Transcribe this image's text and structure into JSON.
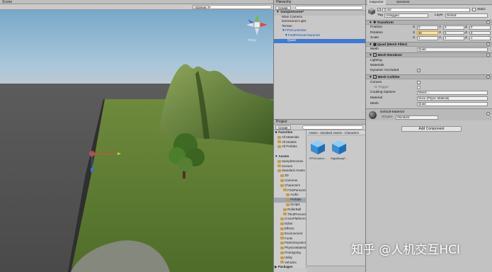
{
  "scene": {
    "tab_label": "Scene",
    "gizmos_label": "Gizmos",
    "persp_label": "Persp"
  },
  "hierarchy": {
    "tab_label": "Hierarchy",
    "create_label": "Create",
    "search_placeholder": "All",
    "scene_name": "SampleScene*",
    "items": [
      {
        "label": "Main Camera",
        "indent": 2,
        "selected": false,
        "prefab": false
      },
      {
        "label": "Directional Light",
        "indent": 2,
        "selected": false,
        "prefab": false
      },
      {
        "label": "Terrain",
        "indent": 2,
        "selected": false,
        "prefab": false
      },
      {
        "label": "▼FPSController",
        "indent": 2,
        "selected": false,
        "prefab": true
      },
      {
        "label": "▼FirstPersonCharacter",
        "indent": 3,
        "selected": false,
        "prefab": true
      },
      {
        "label": "Quad",
        "indent": 4,
        "selected": true,
        "prefab": false
      }
    ]
  },
  "project": {
    "tab_label": "Project",
    "create_label": "Create",
    "breadcrumb": "Assets › Standard Assets › Characters",
    "tree": [
      {
        "label": "★ Favorites",
        "indent": 0,
        "header": true
      },
      {
        "label": "All Materials",
        "indent": 2,
        "header": false
      },
      {
        "label": "All Models",
        "indent": 2,
        "header": false
      },
      {
        "label": "All Prefabs",
        "indent": 2,
        "header": false
      },
      {
        "label": "",
        "indent": 0,
        "header": false
      },
      {
        "label": "▼ Assets",
        "indent": 0,
        "header": true
      },
      {
        "label": "SampleScenes",
        "indent": 2,
        "header": false
      },
      {
        "label": "Scenes",
        "indent": 2,
        "header": false
      },
      {
        "label": "Standard Assets",
        "indent": 2,
        "header": false
      },
      {
        "label": "2D",
        "indent": 4,
        "header": false
      },
      {
        "label": "Cameras",
        "indent": 4,
        "header": false
      },
      {
        "label": "Characters",
        "indent": 4,
        "header": false
      },
      {
        "label": "FirstPersonCharacter",
        "indent": 6,
        "header": false
      },
      {
        "label": "Audio",
        "indent": 8,
        "header": false
      },
      {
        "label": "Prefabs",
        "indent": 8,
        "header": false,
        "selected": true
      },
      {
        "label": "Scripts",
        "indent": 8,
        "header": false
      },
      {
        "label": "RollerBall",
        "indent": 6,
        "header": false
      },
      {
        "label": "ThirdPersonCharacter",
        "indent": 6,
        "header": false
      },
      {
        "label": "CrossPlatformInput",
        "indent": 4,
        "header": false
      },
      {
        "label": "Editor",
        "indent": 4,
        "header": false
      },
      {
        "label": "Effects",
        "indent": 4,
        "header": false
      },
      {
        "label": "Environment",
        "indent": 4,
        "header": false
      },
      {
        "label": "Fonts",
        "indent": 4,
        "header": false
      },
      {
        "label": "ParticleSystems",
        "indent": 4,
        "header": false
      },
      {
        "label": "PhysicsMaterials",
        "indent": 4,
        "header": false
      },
      {
        "label": "Prototyping",
        "indent": 4,
        "header": false
      },
      {
        "label": "Utility",
        "indent": 4,
        "header": false
      },
      {
        "label": "Vehicles",
        "indent": 4,
        "header": false
      },
      {
        "label": "▶ Packages",
        "indent": 0,
        "header": true
      }
    ],
    "assets": [
      {
        "label": "FPSControl..."
      },
      {
        "label": "RigidBodyF..."
      }
    ]
  },
  "inspector": {
    "tab_label": "Inspector",
    "services_label": "Services",
    "object_name": "Quad",
    "static_label": "Static",
    "tag_label": "Tag",
    "tag_value": "Untagged",
    "layer_label": "Layer",
    "layer_value": "Default",
    "transform": {
      "title": "Transform",
      "rows": [
        {
          "label": "Position",
          "x": "0",
          "y": "0",
          "z": "0"
        },
        {
          "label": "Rotation",
          "x": "90",
          "y": "0",
          "z": "0"
        },
        {
          "label": "Scale",
          "x": "1",
          "y": "1",
          "z": "1"
        }
      ]
    },
    "mesh_filter": {
      "title": "Quad (Mesh Filter)",
      "mesh_label": "Mesh",
      "mesh_value": "Quad"
    },
    "mesh_renderer": {
      "title": "Mesh Renderer",
      "lighting": "Lighting",
      "materials": "Materials",
      "dynamic_occluded": "Dynamic Occluded"
    },
    "mesh_collider": {
      "title": "Mesh Collider",
      "convex": "Convex",
      "is_trigger": "Is Trigger",
      "cooking_label": "Cooking Options",
      "cooking_value": "Mixed ...",
      "material_label": "Material",
      "material_value": "None (Physic Material)",
      "mesh_label": "Mesh",
      "mesh_value": "Quad"
    },
    "material": {
      "name": "Default-Material",
      "shader_label": "Shader",
      "shader_value": "Standard"
    },
    "add_component_label": "Add Component"
  },
  "watermark": "知乎 @人机交互HCI"
}
